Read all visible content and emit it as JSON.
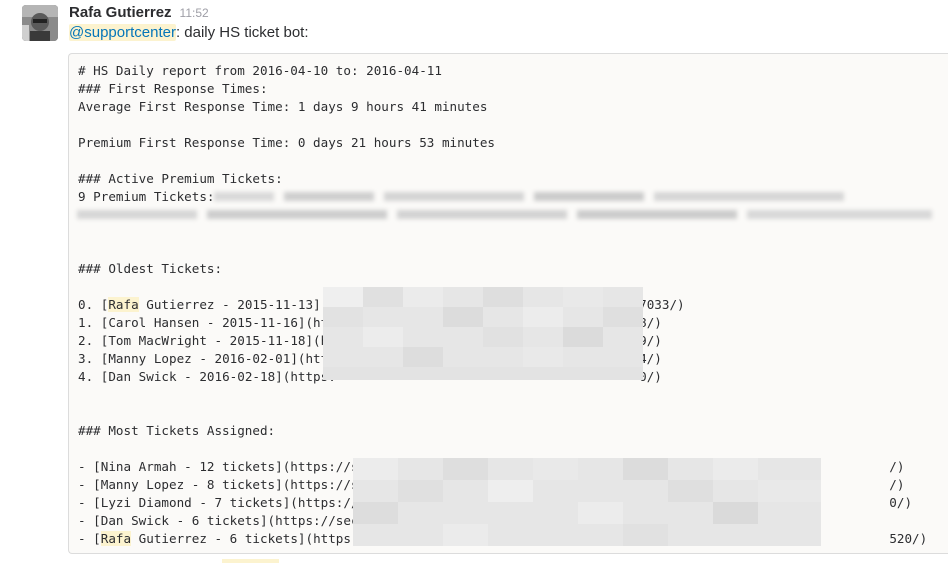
{
  "message": {
    "author": "Rafa Gutierrez",
    "time": "11:52",
    "mention": "@supportcenter",
    "text": ": daily HS ticket bot:"
  },
  "report": {
    "line_title": "# HS Daily report from 2016-04-10 to: 2016-04-11",
    "line_frt_heading": "### First Response Times:",
    "line_avg": "Average First Response Time: 1 days 9 hours 41 minutes",
    "line_premium": "Premium First Response Time: 0 days 21 hours 53 minutes",
    "line_active_heading": "### Active Premium Tickets:",
    "line_premium_count": "9 Premium Tickets:",
    "line_oldest_heading": "### Oldest Tickets:",
    "oldest": [
      {
        "prefix": "0. [",
        "highlight": "Rafa",
        "rest": " Gutierrez - 2015-11-13](ht",
        "tail": "/100727033/)"
      },
      {
        "prefix": "1. [",
        "highlight": "",
        "rest": "Carol Hansen - 2015-11-16](htt",
        "tail": "7828/)"
      },
      {
        "prefix": "2. [",
        "highlight": "",
        "rest": "Tom MacWright - 2015-11-18](ht",
        "tail": "56729/)"
      },
      {
        "prefix": "3. [",
        "highlight": "",
        "rest": "Manny Lopez - 2016-02-01](http",
        "tail": "544/)"
      },
      {
        "prefix": "4. [",
        "highlight": "",
        "rest": "Dan Swick - 2016-02-18](https:",
        "tail": "0/)"
      }
    ],
    "line_assigned_heading": "### Most Tickets Assigned:",
    "assigned": [
      {
        "prefix": "- [",
        "highlight": "",
        "rest": "Nina Armah - 12 tickets](https://se",
        "tail": "/)"
      },
      {
        "prefix": "- [",
        "highlight": "",
        "rest": "Manny Lopez - 8 tickets](https://se",
        "tail": "/)"
      },
      {
        "prefix": "- [",
        "highlight": "",
        "rest": "Lyzi Diamond - 7 tickets](https://s",
        "tail": "0/)"
      },
      {
        "prefix": "- [",
        "highlight": "",
        "rest": "Dan Swick - 6 tickets](https://secu",
        "tail": ""
      },
      {
        "prefix": "- [",
        "highlight": "Rafa",
        "rest": " Gutierrez - 6 tickets](https:/",
        "tail": "520/)"
      }
    ]
  },
  "colors": {
    "mention": "#0576b9",
    "highlight": "#fcf3cf",
    "text": "#2c2d30",
    "timestamp": "#9e9ea6"
  }
}
